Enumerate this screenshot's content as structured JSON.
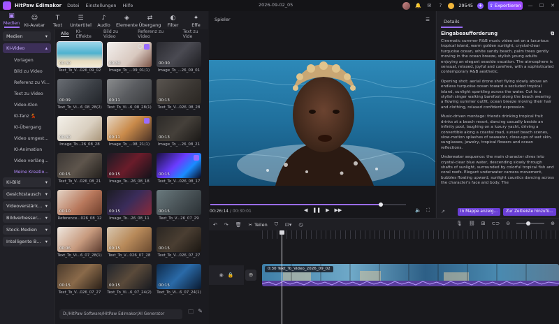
{
  "titlebar": {
    "app_name": "HitPaw Edimakor",
    "menu": [
      "Datei",
      "Einstellungen",
      "Hilfe"
    ],
    "doc_title": "2026-09-02_05",
    "credits": "29545",
    "export_label": "Exportieren"
  },
  "toolbar": {
    "tools": [
      {
        "label": "Medien",
        "icon": "▣"
      },
      {
        "label": "KI-Avatar",
        "icon": "☺"
      },
      {
        "label": "Text",
        "icon": "T"
      },
      {
        "label": "Untertitel",
        "icon": "☰"
      },
      {
        "label": "Audio",
        "icon": "♪"
      },
      {
        "label": "Elemente",
        "icon": "◈"
      },
      {
        "label": "Übergang",
        "icon": "⇄"
      },
      {
        "label": "Filter",
        "icon": "◐"
      },
      {
        "label": "Effe",
        "icon": "✦"
      }
    ]
  },
  "sidebar": {
    "medien": "Medien",
    "ki_video": "KI-Video",
    "items": [
      "Vorlagen",
      "Bild zu Video",
      "Referenz zu Vi...",
      "Text zu Video",
      "Video-Klon",
      "KI-Tanz 💃",
      "KI-Übergang",
      "Video umgest...",
      "KI-Animation",
      "Video verläng...",
      "Meine Kreatio..."
    ],
    "groups": [
      "KI-Bild",
      "Gesichtstausch",
      "Videoverstärk...",
      "Bildverbesser...",
      "Stock-Medien",
      "Intelligente B..."
    ]
  },
  "media": {
    "filters": [
      "Alle",
      "KI-Effekte",
      "Bild zu Video",
      "Referenz zu Video",
      "Text zu Vide"
    ],
    "items": [
      {
        "dur": "00:30",
        "cap": "Text_To_V...026_09_02",
        "style": "sea"
      },
      {
        "dur": "00:30",
        "cap": "Image_To_...09_01(1)",
        "style": "girl"
      },
      {
        "dur": "00:30",
        "cap": "Image_To_...26_09_01",
        "style": "dark"
      },
      {
        "dur": "00:09",
        "cap": "Text_To_Vi...6_08_28(2)",
        "style": "hall"
      },
      {
        "dur": "00:11",
        "cap": "Text_To_Vi...6_08_28(1)",
        "style": "room"
      },
      {
        "dur": "00:13",
        "cap": "Text_To_V...026_08_28",
        "style": "room2"
      },
      {
        "dur": "00:30",
        "cap": "Image_To...26_08_28",
        "style": "bright"
      },
      {
        "dur": "00:11",
        "cap": "Image_To_...08_21(1)",
        "style": "tiger"
      },
      {
        "dur": "00:13",
        "cap": "Image_To_...26_08_21",
        "style": "dark2"
      },
      {
        "dur": "00:15",
        "cap": "Text_To_V...026_08_21",
        "style": "dark3"
      },
      {
        "dur": "00:15",
        "cap": "Image_To...26_08_18",
        "style": "red"
      },
      {
        "dur": "00:15",
        "cap": "Text_To_V...026_08_17",
        "style": "neon"
      },
      {
        "dur": "00:10",
        "cap": "Reference...026_08_12",
        "style": "girl2"
      },
      {
        "dur": "00:15",
        "cap": "Image_To...26_08_11",
        "style": "crowd"
      },
      {
        "dur": "00:15",
        "cap": "Text_To_V...26_07_29",
        "style": "road"
      },
      {
        "dur": "00:06",
        "cap": "Text_To_Vi...6_07_28(1)",
        "style": "woman"
      },
      {
        "dur": "00:15",
        "cap": "Text_To_V...026_07_28",
        "style": "food"
      },
      {
        "dur": "00:15",
        "cap": "Text_To_V...026_07_27",
        "style": "dark4"
      },
      {
        "dur": "00:15",
        "cap": "Text_To_V...026_07_27",
        "style": "brown"
      },
      {
        "dur": "00:15",
        "cap": "Text_To_Vi...6_07_24(2)",
        "style": "street"
      },
      {
        "dur": "00:15",
        "cap": "Text_To_Vi...6_07_24(1)",
        "style": "blue"
      }
    ],
    "path": "D:/HitPaw Software/HitPaw Edimakor/AI Generator"
  },
  "player": {
    "title": "Spieler",
    "current": "00:26:14",
    "total": "00:30:01",
    "progress": 0.87
  },
  "details": {
    "tab": "Details",
    "heading": "Eingabeaufforderung",
    "paragraphs": [
      "Cinematic summer R&B music video set on a luxurious tropical island, warm golden sunlight, crystal-clear turquoise ocean, white sandy beach, palm trees gently moving in the ocean breeze, stylish young adults enjoying an elegant seaside vacation. The atmosphere is sensual, relaxed, joyful and carefree, with a sophisticated contemporary R&B aesthetic.",
      "Opening shot: aerial drone shot flying slowly above an endless turquoise ocean toward a secluded tropical island, sunlight sparkling across the water. Cut to a stylish singer walking barefoot along the beach wearing a flowing summer outfit, ocean breeze moving their hair and clothing, relaxed confident expression.",
      "Music-driven montage: friends drinking tropical fruit drinks at a beach resort, dancing casually beside an infinity pool, laughing on a luxury yacht, driving a convertible along a coastal road, sunset beach scenes, slow-motion splashes of seawater, close-ups of wet skin, sunglasses, jewelry, tropical flowers and ocean reflections.",
      "Underwater sequence: the main character dives into crystal-clear blue water, descending slowly through shafts of sunlight, surrounded by colorful tropical fish and coral reefs. Elegant underwater camera movement, bubbles floating upward, sunlight caustics dancing across the character's face and body. The"
    ],
    "btn_add": "In Mappe anzeig...",
    "btn_timeline": "Zur Zeitleiste hinzufü..."
  },
  "timeline": {
    "split_label": "Teilen",
    "clip_label": "0:30 Text_To_Video_2026_09_02"
  },
  "colors": {
    "accent": "#9a6cff",
    "export": "#8a5cff"
  }
}
